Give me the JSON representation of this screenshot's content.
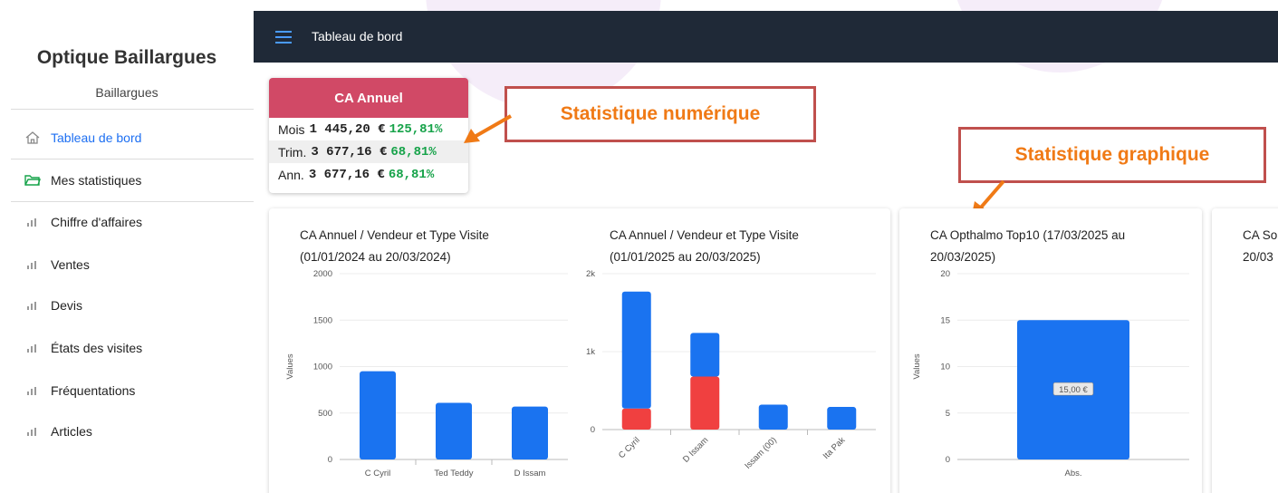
{
  "sidebar": {
    "brand": "Optique Baillargues",
    "subtitle": "Baillargues",
    "items": [
      {
        "label": "Tableau de bord",
        "icon": "home-icon",
        "active": true
      },
      {
        "label": "Mes statistiques",
        "icon": "folder-open-icon",
        "active": false
      },
      {
        "label": "Chiffre d'affaires",
        "icon": "bar-chart-icon",
        "active": false
      },
      {
        "label": "Ventes",
        "icon": "bar-chart-icon",
        "active": false
      },
      {
        "label": "Devis",
        "icon": "bar-chart-icon",
        "active": false
      },
      {
        "label": "États des visites",
        "icon": "bar-chart-icon",
        "active": false
      },
      {
        "label": "Fréquentations",
        "icon": "bar-chart-icon",
        "active": false
      },
      {
        "label": "Articles",
        "icon": "bar-chart-icon",
        "active": false
      }
    ]
  },
  "topbar": {
    "menu_icon": "hamburger-menu-icon",
    "title": "Tableau de bord"
  },
  "ca_card": {
    "title": "CA Annuel",
    "rows": [
      {
        "label": "Mois",
        "value": "1 445,20 €",
        "pct": "125,81%"
      },
      {
        "label": "Trim.",
        "value": "3 677,16 €",
        "pct": "68,81%"
      },
      {
        "label": "Ann.",
        "value": "3 677,16 €",
        "pct": "68,81%"
      }
    ]
  },
  "callouts": {
    "numeric": "Statistique numérique",
    "graphic": "Statistique graphique"
  },
  "colors": {
    "accent": "#1d6ff2",
    "bar_blue": "#1a73f0",
    "bar_red": "#f04040",
    "ca_header": "#d14966",
    "pct_green": "#17a34a",
    "topbar": "#1f2937",
    "callout_text": "#f07a16",
    "callout_border": "#c0504d"
  },
  "chart_cards": [
    {
      "title_line1": "CA Annuel / Vendeur et Type Visite",
      "title_line2": "(01/01/2024 au 20/03/2024)"
    },
    {
      "title_line1": "CA Annuel / Vendeur et Type Visite",
      "title_line2": "(01/01/2025 au 20/03/2025)"
    },
    {
      "title_line1": "CA Opthalmo Top10 (17/03/2025 au",
      "title_line2": "20/03/2025)"
    },
    {
      "title_line1": "CA So",
      "title_line2": "20/03"
    }
  ],
  "chart_data": [
    {
      "type": "bar",
      "title": "CA Annuel / Vendeur et Type Visite (01/01/2024 au 20/03/2024)",
      "ylabel": "Values",
      "ylim": [
        0,
        2000
      ],
      "yticks": [
        "0",
        "500",
        "1000",
        "1500",
        "2000"
      ],
      "categories": [
        "C Cyril",
        "Ted Teddy",
        "D Issam"
      ],
      "values": [
        950,
        610,
        570
      ]
    },
    {
      "type": "bar",
      "stacked": true,
      "title": "CA Annuel / Vendeur et Type Visite (01/01/2025 au 20/03/2025)",
      "ylabel": "Values",
      "ylim": [
        0,
        2000
      ],
      "yticks": [
        "0",
        "1k",
        "2k"
      ],
      "categories": [
        "C Cyril",
        "D Issam",
        "Issam (00)",
        "Ita Pak"
      ],
      "series": [
        {
          "color": "#f04040",
          "values": [
            270,
            680,
            0,
            0
          ]
        },
        {
          "color": "#1a73f0",
          "values": [
            1500,
            560,
            320,
            290
          ]
        }
      ]
    },
    {
      "type": "bar",
      "title": "CA Opthalmo Top10 (17/03/2025 au 20/03/2025)",
      "ylabel": "Values",
      "ylim": [
        0,
        20
      ],
      "yticks": [
        "0",
        "5",
        "10",
        "15",
        "20"
      ],
      "categories": [
        "Abs."
      ],
      "values": [
        15
      ],
      "data_labels": [
        "15,00 €"
      ]
    }
  ]
}
